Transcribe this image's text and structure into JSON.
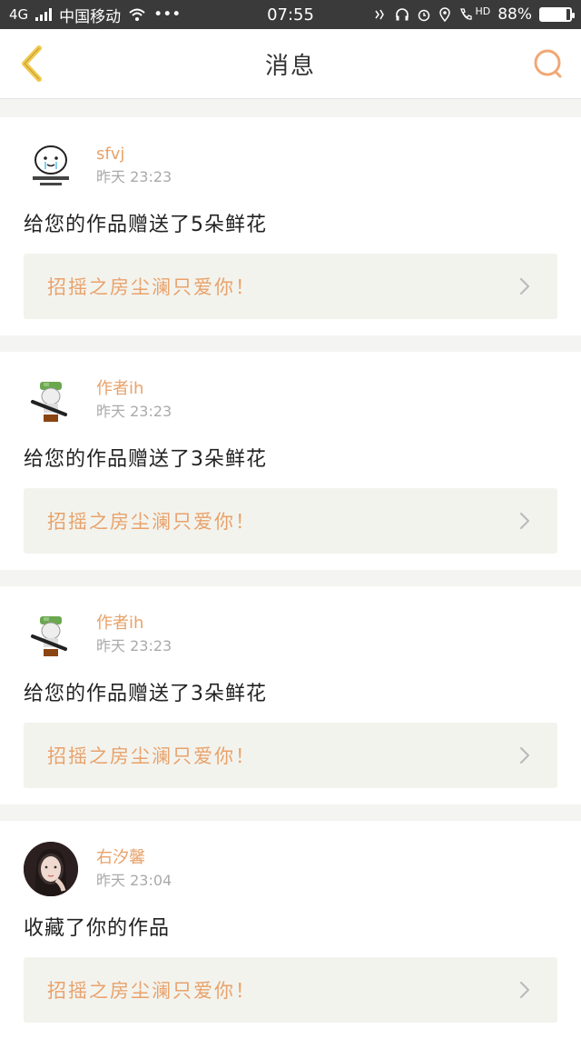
{
  "status_bar": {
    "network": "4G",
    "carrier": "中国移动",
    "dots": "•••",
    "time": "07:55",
    "hd": "HD",
    "battery_pct": "88%",
    "battery_level": 0.88
  },
  "nav": {
    "title": "消息",
    "accent": "#e8a26a",
    "back_color": "#f2c94c"
  },
  "messages": [
    {
      "username": "sfvj",
      "time": "昨天 23:23",
      "text": "给您的作品赠送了5朵鲜花",
      "quote": "招摇之房尘澜只爱你！",
      "avatar": "cartoon-face-avatar"
    },
    {
      "username": "作者ih",
      "time": "昨天 23:23",
      "text": "给您的作品赠送了3朵鲜花",
      "quote": "招摇之房尘澜只爱你！",
      "avatar": "soldier-figure-avatar"
    },
    {
      "username": "作者ih",
      "time": "昨天 23:23",
      "text": "给您的作品赠送了3朵鲜花",
      "quote": "招摇之房尘澜只爱你！",
      "avatar": "soldier-figure-avatar"
    },
    {
      "username": "右汐馨",
      "time": "昨天 23:04",
      "text": "收藏了你的作品",
      "quote": "招摇之房尘澜只爱你！",
      "avatar": "photo-avatar"
    }
  ]
}
